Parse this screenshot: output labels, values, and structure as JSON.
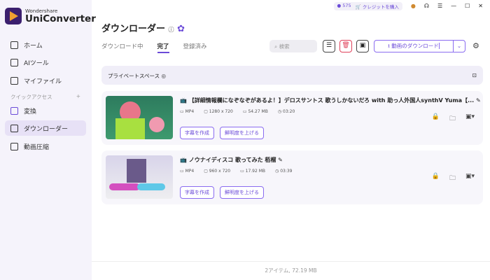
{
  "app": {
    "brand_small": "Wondershare",
    "brand": "UniConverter"
  },
  "sidebar": {
    "items": [
      {
        "label": "ホーム"
      },
      {
        "label": "AIツール"
      },
      {
        "label": "マイファイル"
      },
      {
        "label": "変換"
      },
      {
        "label": "ダウンローダー"
      },
      {
        "label": "動画圧縮"
      }
    ],
    "quick_access": "クイックアクセス",
    "add": "+"
  },
  "topbar": {
    "credits": "575",
    "buy": "クレジットを購入"
  },
  "header": {
    "title": "ダウンローダー",
    "tabs": [
      "ダウンロード中",
      "完了",
      "登録済み"
    ],
    "active_tab": 1,
    "search_placeholder": "検索",
    "download_label": "動画のダウンロード"
  },
  "private_space": "プライベートスペース",
  "items": [
    {
      "title": "【詳細情報欄になぞなぞがあるよ！】デロスサントス 歌うしかないだろ with 助っ人外国人synthV Yuma【...",
      "format": "MP4",
      "resolution": "1280 x 720",
      "size": "54.27 MB",
      "duration": "03:20"
    },
    {
      "title": "ノウナイディスコ 歌ってみた 栢榴",
      "format": "MP4",
      "resolution": "960 x 720",
      "size": "17.92 MB",
      "duration": "03:39"
    }
  ],
  "actions": {
    "subtitle": "字幕を作成",
    "enhance": "鮮明度を上げる"
  },
  "footer": "2アイテム, 72.19 MB",
  "colors": {
    "accent": "#6b4bd8",
    "delete": "#e0405a"
  }
}
